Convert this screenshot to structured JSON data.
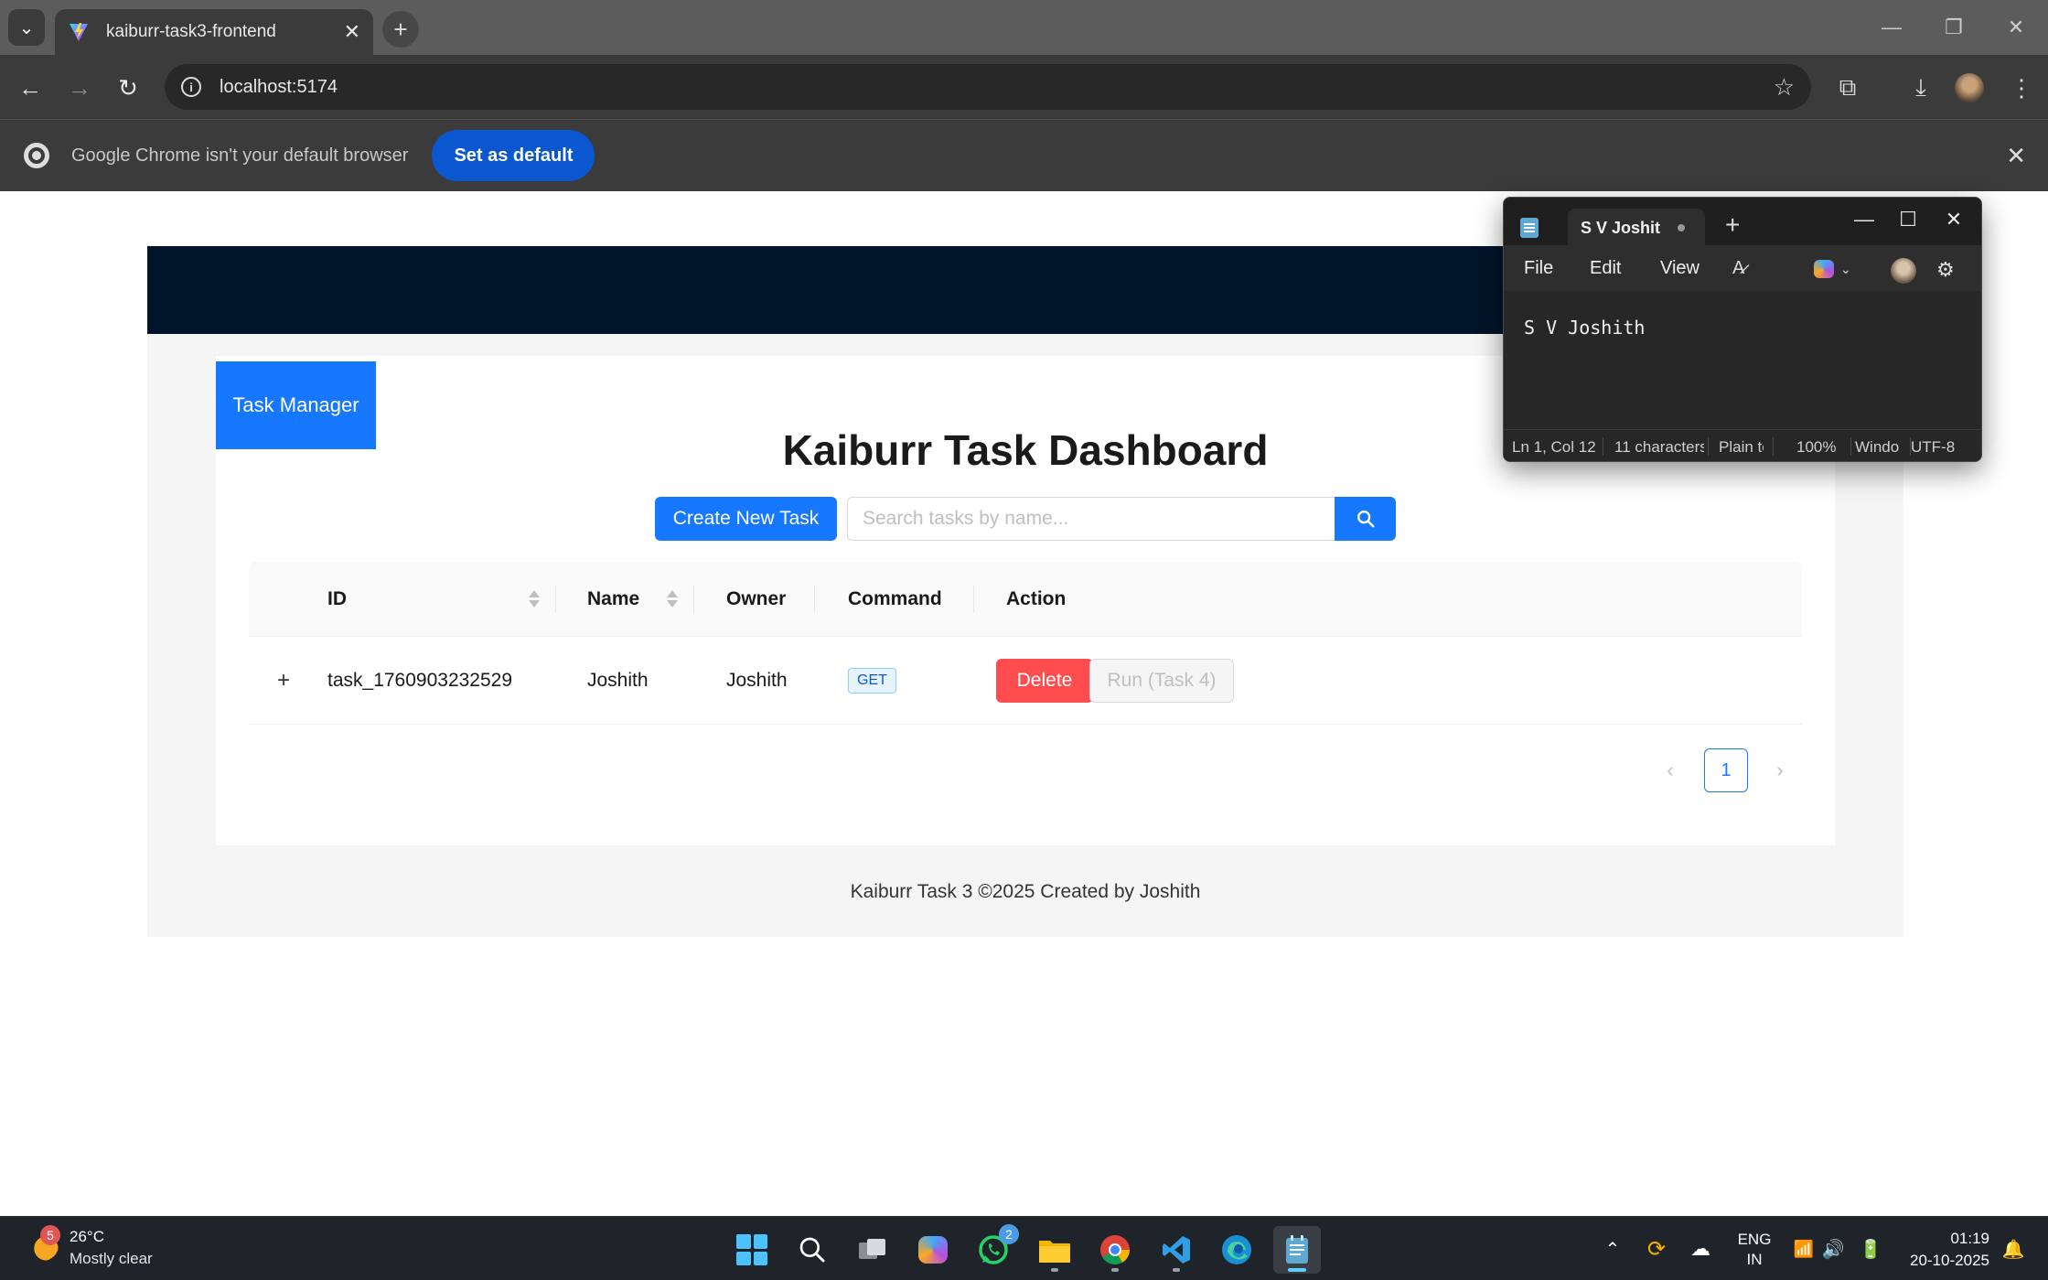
{
  "browser": {
    "tab_title": "kaiburr-task3-frontend",
    "url": "localhost:5174",
    "infobar_text": "Google Chrome isn't your default browser",
    "set_default_label": "Set as default"
  },
  "app": {
    "brand": "Task Manager",
    "title": "Kaiburr Task Dashboard",
    "create_button": "Create New Task",
    "search_placeholder": "Search tasks by name...",
    "table": {
      "headers": [
        "ID",
        "Name",
        "Owner",
        "Command",
        "Action"
      ],
      "rows": [
        {
          "id": "task_1760903232529",
          "name": "Joshith",
          "owner": "Joshith",
          "command": "GET",
          "delete_label": "Delete",
          "run_label": "Run (Task 4)"
        }
      ]
    },
    "pagination": {
      "current_page": "1"
    },
    "footer": "Kaiburr Task 3 ©2025 Created by Joshith"
  },
  "notepad": {
    "tab_title": "S V Joshit",
    "menu": [
      "File",
      "Edit",
      "View"
    ],
    "content": "S V Joshith",
    "status": {
      "position": "Ln 1, Col 12",
      "chars": "11 characters",
      "format": "Plain text",
      "zoom": "100%",
      "line_ending": "Windows (CRLF)",
      "encoding": "UTF-8"
    }
  },
  "taskbar": {
    "weather_badge": "5",
    "temperature": "26°C",
    "weather": "Mostly clear",
    "whatsapp_badge": "2",
    "lang_line1": "ENG",
    "lang_line2": "IN",
    "time": "01:19",
    "date": "20-10-2025"
  },
  "colors": {
    "primary": "#1677ff",
    "danger": "#ff4d4f",
    "header_dark": "#001529",
    "chrome_button": "#0b57d0"
  }
}
